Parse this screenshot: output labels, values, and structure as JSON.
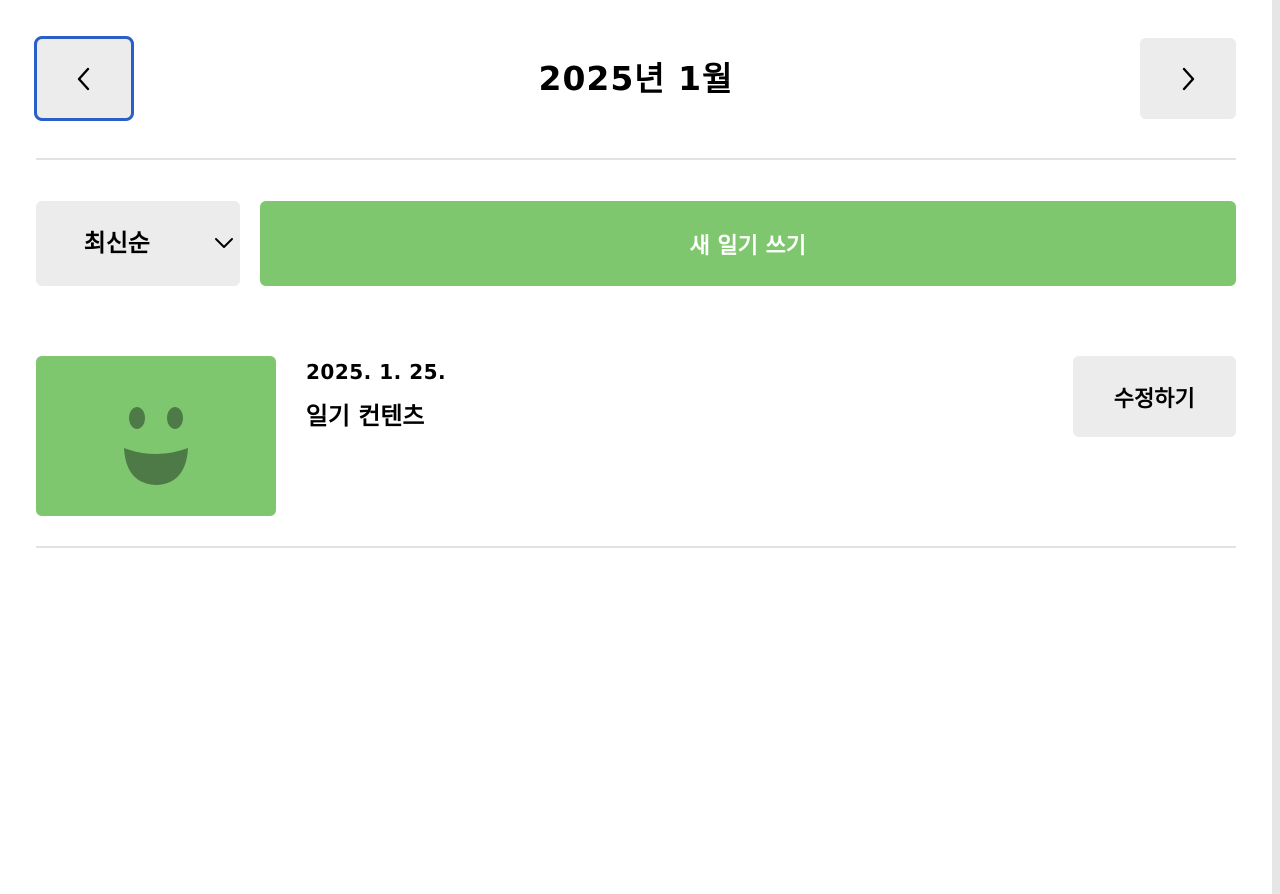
{
  "header": {
    "title": "2025년 1월",
    "prev_icon": "chevron-left-icon",
    "next_icon": "chevron-right-icon"
  },
  "menu": {
    "sort_selected": "최신순",
    "sort_icon": "chevron-down-icon",
    "new_button_label": "새 일기 쓰기"
  },
  "diary_items": [
    {
      "date": "2025. 1. 25.",
      "content": "일기 컨텐츠",
      "emotion_icon": "smile-emotion-icon",
      "edit_label": "수정하기"
    }
  ],
  "colors": {
    "accent_green": "#7fc76e",
    "button_gray": "#ececec",
    "focus_blue": "#2a5fc8",
    "emotion_face": "#4e7a48"
  }
}
